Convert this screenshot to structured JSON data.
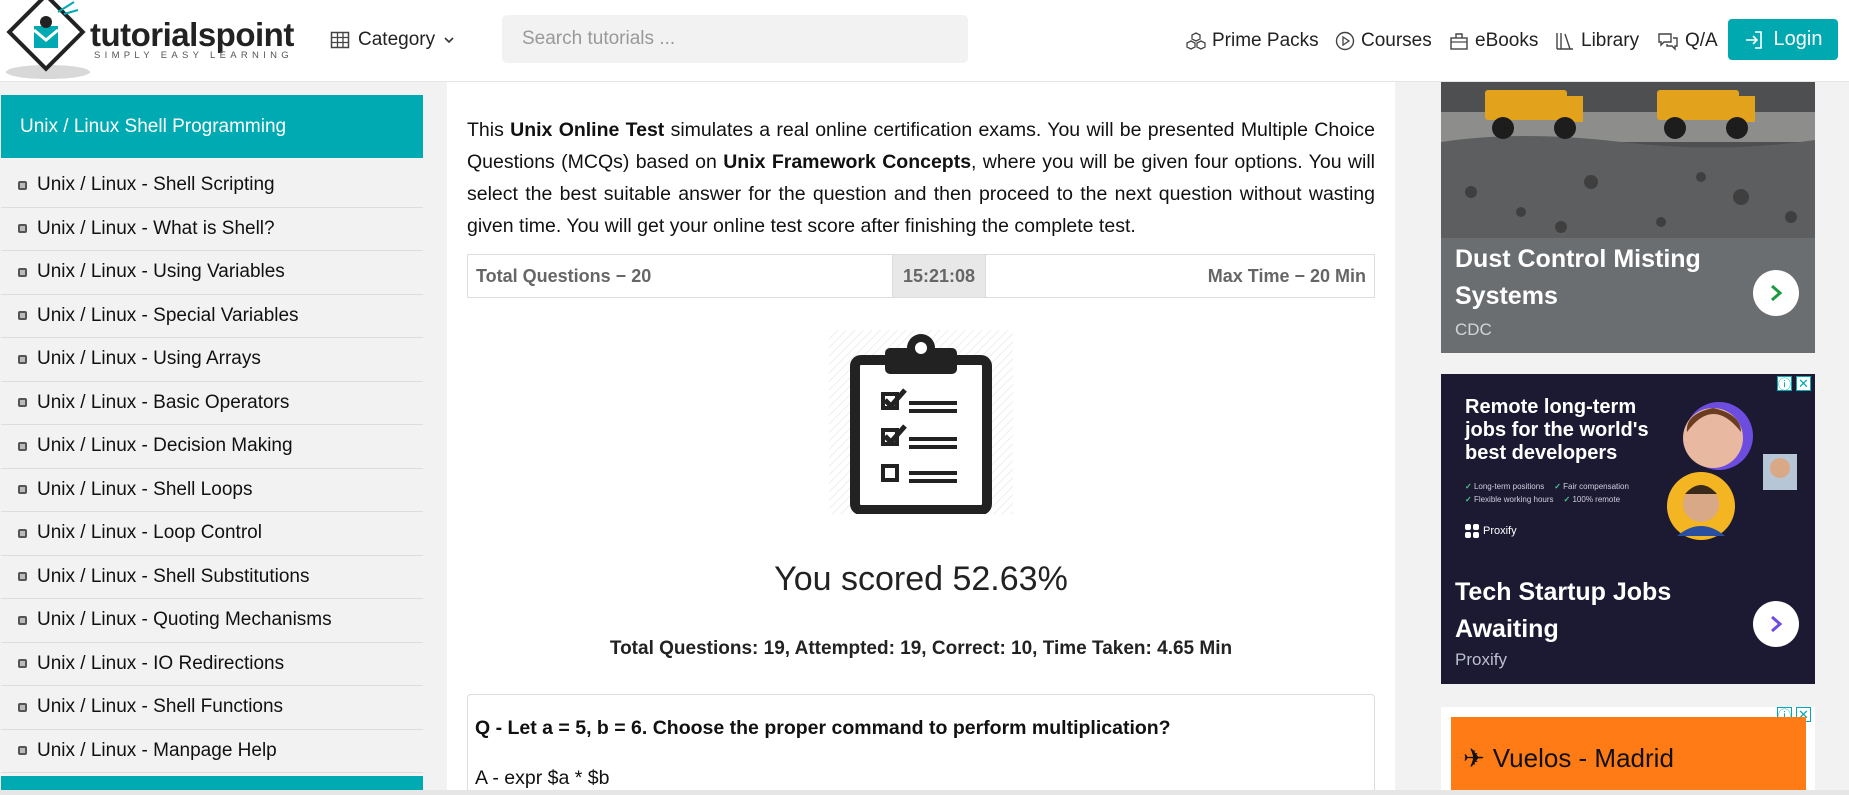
{
  "header": {
    "logo_name": "tutorialspoint",
    "logo_tagline": "SIMPLY EASY LEARNING",
    "category_label": "Category",
    "search_placeholder": "Search tutorials ...",
    "nav": [
      {
        "label": "Prime Packs",
        "icon": "cubes-icon"
      },
      {
        "label": "Courses",
        "icon": "play-circle-icon"
      },
      {
        "label": "eBooks",
        "icon": "book-icon"
      },
      {
        "label": "Library",
        "icon": "library-icon"
      },
      {
        "label": "Q/A",
        "icon": "chat-icon"
      }
    ],
    "login_label": "Login"
  },
  "sidebar": {
    "title": "Unix / Linux Shell Programming",
    "items": [
      "Unix / Linux - Shell Scripting",
      "Unix / Linux - What is Shell?",
      "Unix / Linux - Using Variables",
      "Unix / Linux - Special Variables",
      "Unix / Linux - Using Arrays",
      "Unix / Linux - Basic Operators",
      "Unix / Linux - Decision Making",
      "Unix / Linux - Shell Loops",
      "Unix / Linux - Loop Control",
      "Unix / Linux - Shell Substitutions",
      "Unix / Linux - Quoting Mechanisms",
      "Unix / Linux - IO Redirections",
      "Unix / Linux - Shell Functions",
      "Unix / Linux - Manpage Help"
    ]
  },
  "main": {
    "intro": {
      "p1": "This ",
      "b1": "Unix Online Test",
      "p2": " simulates a real online certification exams. You will be presented Multiple Choice Questions (MCQs) based on ",
      "b2": "Unix Framework Concepts",
      "p3": ", where you will be given four options. You will select the best suitable answer for the question and then proceed to the next question without wasting given time. You will get your online test score after finishing the complete test."
    },
    "total_questions": "Total Questions − 20",
    "timer": "15:21:08",
    "max_time": "Max Time − 20 Min",
    "score": "You scored 52.63%",
    "stats": "Total Questions: 19, Attempted: 19, Correct: 10, Time Taken: 4.65 Min",
    "question": "Q - Let a = 5, b = 6. Choose the proper command to perform multiplication?",
    "option_a": "A - expr $a * $b"
  },
  "ads": {
    "ad1_title": "Dust Control Misting Systems",
    "ad1_source": "CDC",
    "ad2_headline": "Remote long-term jobs for the world's best developers",
    "ad2_features": [
      "Long-term positions",
      "Fair compensation",
      "Flexible working hours",
      "100% remote"
    ],
    "ad2_brand": "Proxify",
    "ad2_title": "Tech Startup Jobs Awaiting",
    "ad2_source": "Proxify",
    "ad3_title": "Vuelos - Madrid"
  },
  "colors": {
    "accent": "#00aab3",
    "sidebar_bg": "#f2f2f2",
    "ad_orange": "#ff7b16",
    "ad_dark": "#1c1a33"
  }
}
